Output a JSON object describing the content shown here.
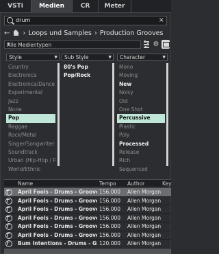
{
  "tabs": [
    {
      "label": "VSTi",
      "active": false
    },
    {
      "label": "Medien",
      "active": true
    },
    {
      "label": "CR",
      "active": false
    },
    {
      "label": "Meter",
      "active": false
    }
  ],
  "search": {
    "value": "drum",
    "clear_icon": "close-icon"
  },
  "breadcrumb": {
    "path": [
      "Loops und Samples",
      "Production Grooves"
    ]
  },
  "media_type": {
    "selected": "Alle Medientypen"
  },
  "filters": {
    "style": {
      "header": "Style",
      "items": [
        "Country",
        "Electronica",
        "Electronica/Dance",
        "Experimental",
        "Jazz",
        "None",
        "Pop",
        "Reggae",
        "Rock/Metal",
        "Singer/Songwriter",
        "Soundtrack",
        "Urban (Hip-Hop / R&",
        "World/Ethnic"
      ],
      "selected": "Pop"
    },
    "sub_style": {
      "header": "Sub Style",
      "items": [
        "80's Pop",
        "Pop/Rock"
      ],
      "bold": [
        "80's Pop",
        "Pop/Rock"
      ]
    },
    "character": {
      "header": "Character",
      "items": [
        "Mono",
        "Moving",
        "New",
        "Noisy",
        "Old",
        "One Shot",
        "Percussive",
        "Plastic",
        "Poly",
        "Processed",
        "Release",
        "Rich",
        "Sequenced"
      ],
      "bold": [
        "New",
        "Processed"
      ],
      "selected": "Percussive"
    }
  },
  "results": {
    "columns": [
      "Name",
      "Tempo",
      "Author",
      "Key"
    ],
    "rows": [
      {
        "name": "April Fools - Drums - Groove 03",
        "tempo": "156.000",
        "author": "Allen Morgan"
      },
      {
        "name": "April Fools - Drums - Groove 04",
        "tempo": "156.000",
        "author": "Allen Morgan"
      },
      {
        "name": "April Fools - Drums - Groove 05",
        "tempo": "156.000",
        "author": "Allen Morgan"
      },
      {
        "name": "April Fools - Drums - Groove 06",
        "tempo": "156.000",
        "author": "Allen Morgan"
      },
      {
        "name": "April Fools - Drums - Groove 07",
        "tempo": "156.000",
        "author": "Allen Morgan"
      },
      {
        "name": "April Fools - Drums - Groove 08",
        "tempo": "156.000",
        "author": "Allen Morgan"
      },
      {
        "name": "Bum Intentions - Drums - Groove 0",
        "tempo": "120.000",
        "author": "Allen Morgan"
      }
    ]
  },
  "colors": {
    "background": "#2b2d30",
    "selection": "#bfe6d6",
    "active_row": "#6b6d71"
  }
}
